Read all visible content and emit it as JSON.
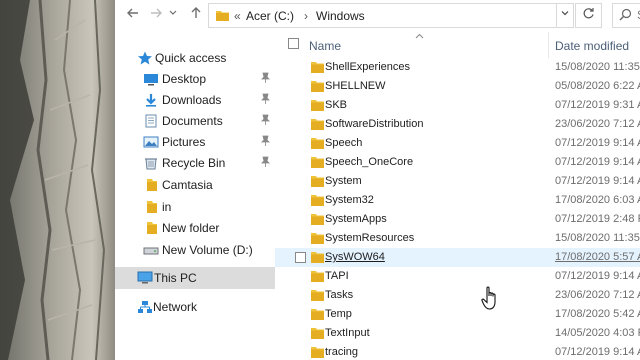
{
  "window": {
    "nav": {
      "back_icon": "arrow-left-icon",
      "forward_icon": "arrow-right-icon",
      "history_icon": "chevron-down-icon",
      "up_icon": "arrow-up-icon"
    },
    "address": {
      "overflow": "«",
      "crumbs": [
        "Acer (C:)",
        "Windows"
      ],
      "separator": "›"
    },
    "search": {
      "placeholder": "Search Windows"
    }
  },
  "navpane": {
    "items": [
      {
        "label": "Quick access",
        "icon": "star-icon",
        "pinned": false
      },
      {
        "label": "Desktop",
        "icon": "desktop-icon",
        "pinned": true
      },
      {
        "label": "Downloads",
        "icon": "download-icon",
        "pinned": true
      },
      {
        "label": "Documents",
        "icon": "documents-icon",
        "pinned": true
      },
      {
        "label": "Pictures",
        "icon": "pictures-icon",
        "pinned": true
      },
      {
        "label": "Recycle Bin",
        "icon": "recycle-bin-icon",
        "pinned": true
      },
      {
        "label": "Camtasia",
        "icon": "folder-icon",
        "pinned": false
      },
      {
        "label": "in",
        "icon": "folder-icon",
        "pinned": false
      },
      {
        "label": "New folder",
        "icon": "folder-icon",
        "pinned": false
      },
      {
        "label": "New Volume (D:)",
        "icon": "drive-icon",
        "pinned": false
      },
      {
        "label": "This PC",
        "icon": "this-pc-icon",
        "pinned": false,
        "selected": true
      },
      {
        "label": "Network",
        "icon": "network-icon",
        "pinned": false
      }
    ],
    "pin_icon": "pin-icon"
  },
  "list": {
    "columns": {
      "name": "Name",
      "date": "Date modified"
    },
    "rows": [
      {
        "name": "ShellExperiences",
        "date": "15/08/2020 11:35"
      },
      {
        "name": "SHELLNEW",
        "date": "05/08/2020 6:22 A"
      },
      {
        "name": "SKB",
        "date": "07/12/2019 9:31 A"
      },
      {
        "name": "SoftwareDistribution",
        "date": "23/06/2020 7:12 A"
      },
      {
        "name": "Speech",
        "date": "07/12/2019 9:14 A"
      },
      {
        "name": "Speech_OneCore",
        "date": "07/12/2019 9:14 A"
      },
      {
        "name": "System",
        "date": "07/12/2019 9:14 A"
      },
      {
        "name": "System32",
        "date": "17/08/2020 6:03 A"
      },
      {
        "name": "SystemApps",
        "date": "07/12/2019 2:48 P"
      },
      {
        "name": "SystemResources",
        "date": "15/08/2020 11:35"
      },
      {
        "name": "SysWOW64",
        "date": "17/08/2020 5:57 A",
        "hover": true
      },
      {
        "name": "TAPI",
        "date": "07/12/2019 9:14 A"
      },
      {
        "name": "Tasks",
        "date": "23/06/2020 7:12 A"
      },
      {
        "name": "Temp",
        "date": "17/08/2020 5:42 A"
      },
      {
        "name": "TextInput",
        "date": "14/05/2020 4:03 P"
      },
      {
        "name": "tracing",
        "date": "07/12/2019 9:14 A"
      }
    ]
  },
  "colors": {
    "folder": "#f0c33c",
    "hover_row": "#e5f3ff",
    "nav_selected": "#dcdcdc",
    "header_text": "#4c6078"
  }
}
